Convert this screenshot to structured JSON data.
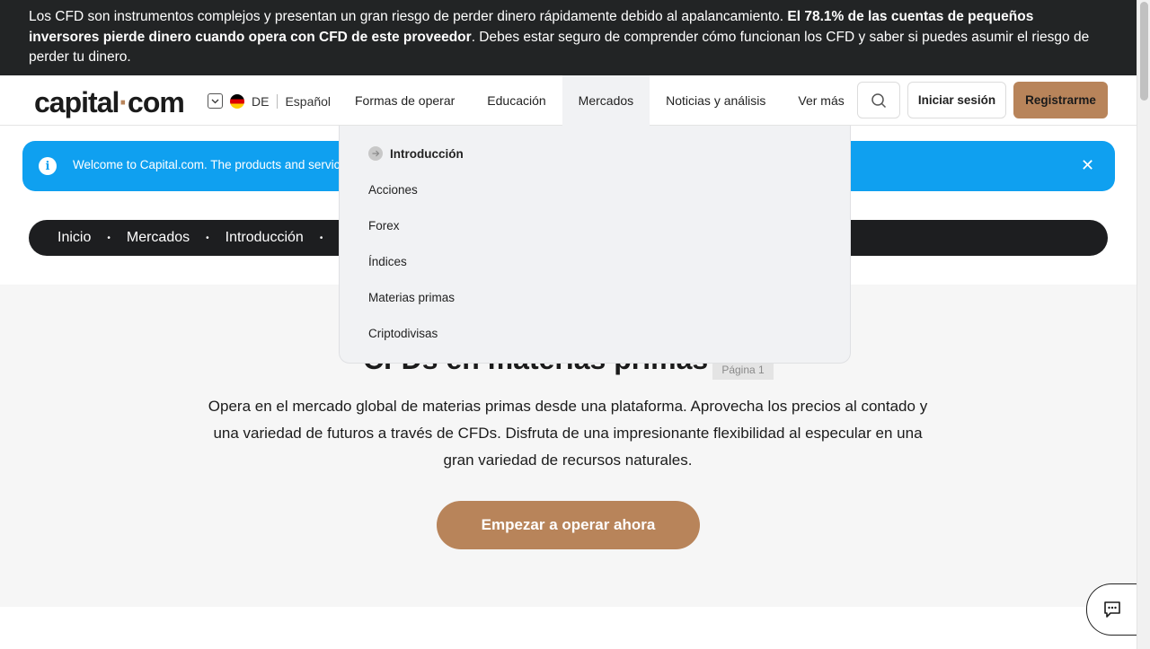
{
  "risk_banner": {
    "text_before": "Los CFD son instrumentos complejos y presentan un gran riesgo de perder dinero rápidamente debido al apalancamiento. ",
    "text_bold": "El 78.1% de las cuentas de pequeños inversores pierde dinero cuando opera con CFD de este proveedor",
    "text_after": ". Debes estar seguro de comprender cómo funcionan los CFD y saber si puedes asumir el riesgo de perder tu dinero."
  },
  "header": {
    "logo_main": "capital",
    "logo_dot": "·",
    "logo_end": "com",
    "region_code": "DE",
    "language": "Español",
    "nav": [
      {
        "label": "Formas de operar"
      },
      {
        "label": "Educación"
      },
      {
        "label": "Mercados"
      },
      {
        "label": "Noticias y análisis"
      },
      {
        "label": "Ver más"
      }
    ],
    "login_label": "Iniciar sesión",
    "register_label": "Registrarme"
  },
  "welcome": {
    "message": "Welcome to Capital.com. The products and servic",
    "close_glyph": "✕",
    "info_glyph": "i"
  },
  "breadcrumb": {
    "items": [
      "Inicio",
      "Mercados",
      "Introducción"
    ],
    "separator": "•"
  },
  "hero": {
    "title": "CFDs en materias primas",
    "page_badge": "Página 1",
    "description": "Opera en el mercado global de materias primas desde una plataforma. Aprovecha los precios al contado y una variedad de futuros a través de CFDs. Disfruta de una impresionante flexibilidad al especular en una gran variedad de recursos naturales.",
    "cta_label": "Empezar a operar ahora"
  },
  "dropdown": {
    "items": [
      "Introducción",
      "Acciones",
      "Forex",
      "Índices",
      "Materias primas",
      "Criptodivisas"
    ]
  },
  "colors": {
    "accent": "#b8845a",
    "info_blue": "#0fa0f0",
    "dark": "#222425"
  }
}
